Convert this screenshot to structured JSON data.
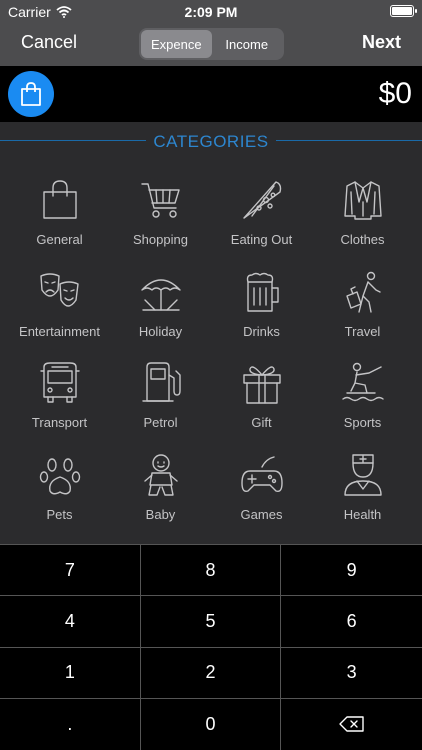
{
  "status": {
    "carrier": "Carrier",
    "time": "2:09 PM"
  },
  "nav": {
    "cancel_label": "Cancel",
    "next_label": "Next",
    "segments": [
      {
        "label": "Expence",
        "selected": true
      },
      {
        "label": "Income",
        "selected": false
      }
    ]
  },
  "amount": {
    "value": "$0",
    "selected_category_icon": "shopping-bag-icon",
    "badge_color": "#1a8bf2"
  },
  "categories": {
    "title": "CATEGORIES",
    "items": [
      {
        "label": "General",
        "icon": "shopping-bag-icon"
      },
      {
        "label": "Shopping",
        "icon": "cart-icon"
      },
      {
        "label": "Eating Out",
        "icon": "pizza-icon"
      },
      {
        "label": "Clothes",
        "icon": "suit-icon"
      },
      {
        "label": "Entertainment",
        "icon": "theater-masks-icon"
      },
      {
        "label": "Holiday",
        "icon": "beach-umbrella-icon"
      },
      {
        "label": "Drinks",
        "icon": "beer-mug-icon"
      },
      {
        "label": "Travel",
        "icon": "traveler-icon"
      },
      {
        "label": "Transport",
        "icon": "bus-icon"
      },
      {
        "label": "Petrol",
        "icon": "fuel-pump-icon"
      },
      {
        "label": "Gift",
        "icon": "gift-icon"
      },
      {
        "label": "Sports",
        "icon": "water-ski-icon"
      },
      {
        "label": "Pets",
        "icon": "paw-icon"
      },
      {
        "label": "Baby",
        "icon": "baby-icon"
      },
      {
        "label": "Games",
        "icon": "gamepad-icon"
      },
      {
        "label": "Health",
        "icon": "doctor-icon"
      }
    ]
  },
  "keypad": {
    "keys": [
      "7",
      "8",
      "9",
      "4",
      "5",
      "6",
      "1",
      "2",
      "3",
      ".",
      "0",
      ""
    ],
    "backspace_icon": "backspace-icon"
  },
  "colors": {
    "accent": "#2d86cf",
    "bar": "#4c4c4e",
    "background": "#2b2b2d"
  }
}
